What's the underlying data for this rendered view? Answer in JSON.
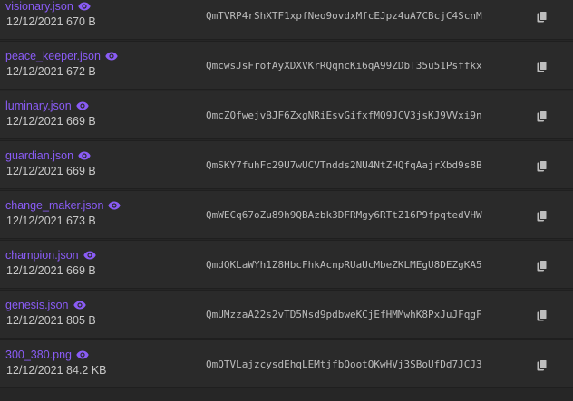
{
  "colors": {
    "background": "#262626",
    "row_background": "#2a2a2a",
    "file_name": "#8a5cf6",
    "meta_text": "#c8c8c8",
    "hash_text": "#bcbcbc",
    "icon": "#bdbdbd"
  },
  "icons": {
    "preview": "eye-icon",
    "copy": "copy-icon"
  },
  "files": [
    {
      "name": "visionary.json",
      "date": "12/12/2021",
      "size": "670 B",
      "hash": "QmTVRP4rShXTF1xpfNeo9ovdxMfcEJpz4uA7CBcjC4ScnM"
    },
    {
      "name": "peace_keeper.json",
      "date": "12/12/2021",
      "size": "672 B",
      "hash": "QmcwsJsFrofAyXDXVKrRQqncKi6qA99ZDbT35u51Psffkx"
    },
    {
      "name": "luminary.json",
      "date": "12/12/2021",
      "size": "669 B",
      "hash": "QmcZQfwejvBJF6ZxgNRiEsvGifxfMQ9JCV3jsKJ9VVxi9n"
    },
    {
      "name": "guardian.json",
      "date": "12/12/2021",
      "size": "669 B",
      "hash": "QmSKY7fuhFc29U7wUCVTndds2NU4NtZHQfqAajrXbd9s8B"
    },
    {
      "name": "change_maker.json",
      "date": "12/12/2021",
      "size": "673 B",
      "hash": "QmWECq67oZu89h9QBAzbk3DFRMgy6RTtZ16P9fpqtedVHW"
    },
    {
      "name": "champion.json",
      "date": "12/12/2021",
      "size": "669 B",
      "hash": "QmdQKLaWYh1Z8HbcFhkAcnpRUaUcMbeZKLMEgU8DEZgKA5"
    },
    {
      "name": "genesis.json",
      "date": "12/12/2021",
      "size": "805 B",
      "hash": "QmUMzzaA22s2vTD5Nsd9pdbweKCjEfHMMwhK8PxJuJFqgF"
    },
    {
      "name": "300_380.png",
      "date": "12/12/2021",
      "size": "84.2 KB",
      "hash": "QmQTVLajzcysdEhqLEMtjfbQootQKwHVj3SBoUfDd7JCJ3"
    }
  ]
}
